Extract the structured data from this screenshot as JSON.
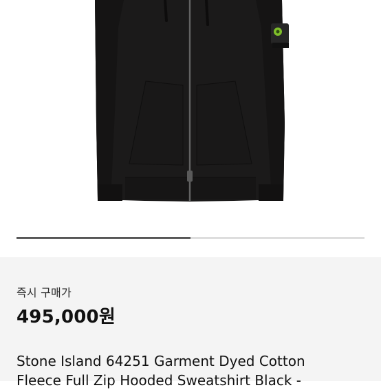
{
  "gallery": {
    "image_alt": "Stone Island garment dyed cotton fleece full zip hooded sweatshirt, black",
    "progress_fraction": 0.5
  },
  "purchase": {
    "label": "즉시 구매가",
    "price": "495,000원"
  },
  "product": {
    "title_line1": "Stone Island 64251 Garment Dyed Cotton",
    "title_line2": "Fleece Full Zip Hooded Sweatshirt Black -"
  },
  "colors": {
    "garment": "#1b1a1a",
    "badge": "#7fbf2a",
    "progress": "#2a2a2a",
    "track": "#d4d4d4",
    "panel": "#f4f4f4"
  }
}
